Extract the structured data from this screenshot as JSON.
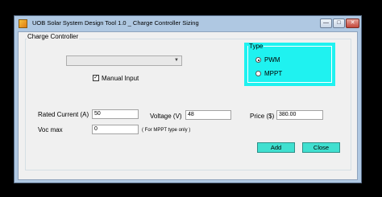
{
  "window": {
    "title": "UOB Solar System Design Tool 1.0 _ Charge Controller Sizing",
    "minimize_glyph": "—",
    "maximize_glyph": "□",
    "close_glyph": "✕",
    "app_icon": "solar-app-icon"
  },
  "group": {
    "label": "Charge Controller"
  },
  "controller_select": {
    "value": "",
    "arrow_glyph": "▼"
  },
  "manual_input": {
    "label": "Manual Input",
    "checked": true,
    "check_glyph": "✓"
  },
  "type": {
    "label": "Type",
    "options": [
      {
        "label": "PWM",
        "selected": true
      },
      {
        "label": "MPPT",
        "selected": false
      }
    ],
    "background_color": "#1ff2f0"
  },
  "fields": {
    "rated_current": {
      "label": "Rated Current (A)",
      "value": "50"
    },
    "voltage": {
      "label": "Voltage (V)",
      "value": "48"
    },
    "price": {
      "label": "Price ($)",
      "value": "380.00"
    },
    "voc_max": {
      "label": "Voc max",
      "value": "0",
      "hint": "( For MPPT type only )"
    }
  },
  "buttons": {
    "add": "Add",
    "close": "Close",
    "color": "#40e0d0"
  }
}
